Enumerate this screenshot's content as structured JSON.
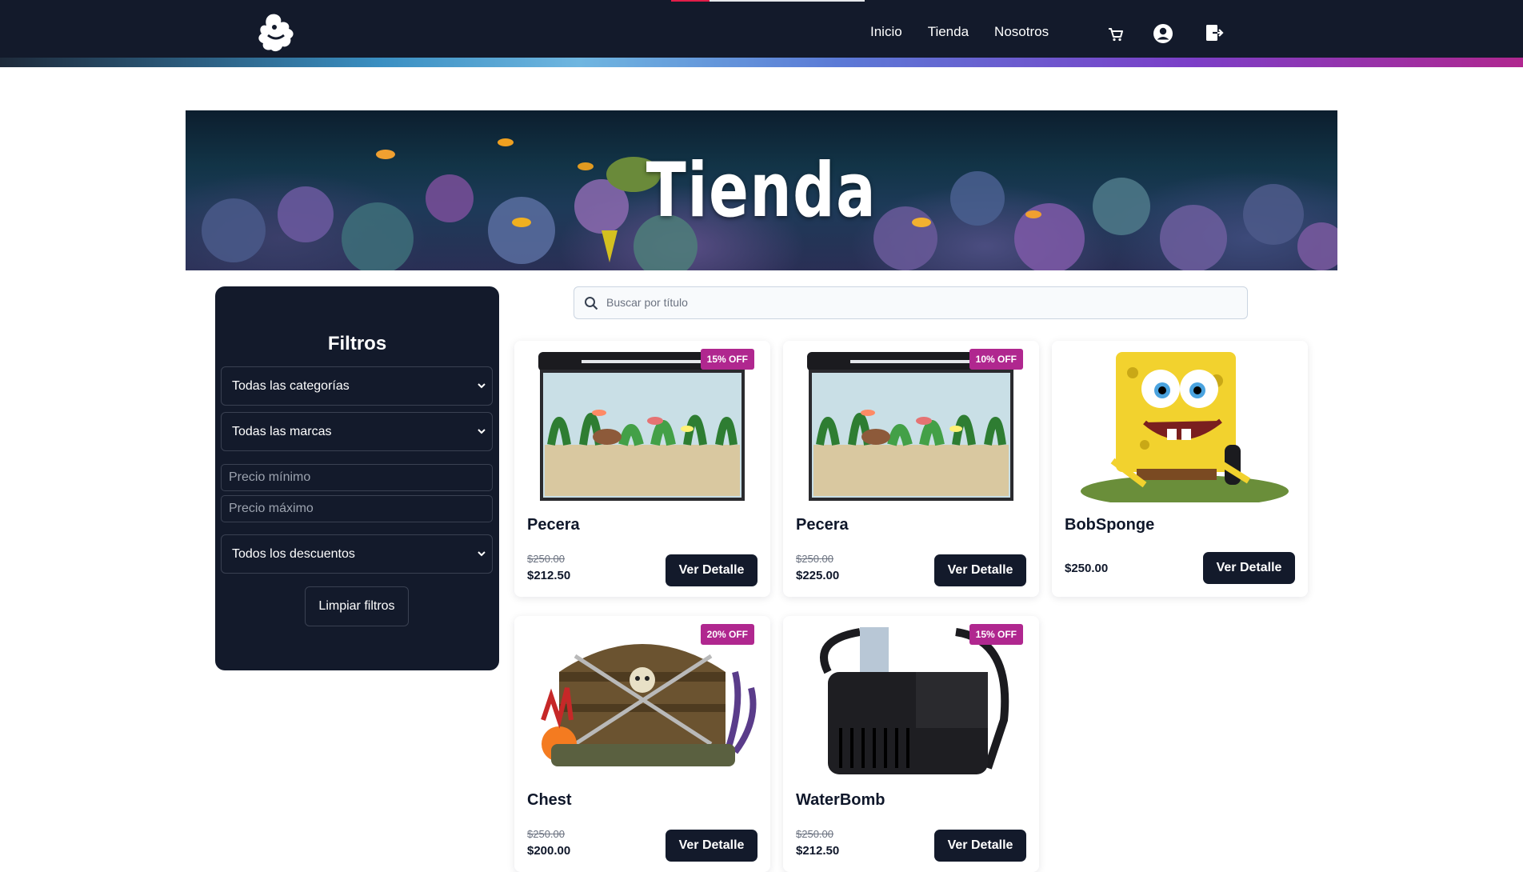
{
  "nav": {
    "links": [
      "Inicio",
      "Tienda",
      "Nosotros"
    ],
    "icons": [
      "cart-icon",
      "user-icon",
      "logout-icon"
    ]
  },
  "hero": {
    "title": "Tienda"
  },
  "filters": {
    "title": "Filtros",
    "category_select": "Todas las categorías",
    "brand_select": "Todas las marcas",
    "min_price_placeholder": "Precio mínimo",
    "max_price_placeholder": "Precio máximo",
    "discount_select": "Todos los descuentos",
    "clear_button": "Limpiar filtros"
  },
  "search": {
    "placeholder": "Buscar por título"
  },
  "products": [
    {
      "name": "Pecera",
      "badge": "15% OFF",
      "old_price": "$250.00",
      "price": "$212.50",
      "button": "Ver Detalle",
      "image": "aquarium"
    },
    {
      "name": "Pecera",
      "badge": "10% OFF",
      "old_price": "$250.00",
      "price": "$225.00",
      "button": "Ver Detalle",
      "image": "aquarium"
    },
    {
      "name": "BobSponge",
      "badge": "",
      "old_price": "",
      "price": "$250.00",
      "button": "Ver Detalle",
      "image": "sponge-figure"
    },
    {
      "name": "Chest",
      "badge": "20% OFF",
      "old_price": "$250.00",
      "price": "$200.00",
      "button": "Ver Detalle",
      "image": "treasure-chest"
    },
    {
      "name": "WaterBomb",
      "badge": "15% OFF",
      "old_price": "$250.00",
      "price": "$212.50",
      "button": "Ver Detalle",
      "image": "water-pump"
    }
  ],
  "colors": {
    "navy": "#131a2b",
    "badge": "#b0278f"
  }
}
